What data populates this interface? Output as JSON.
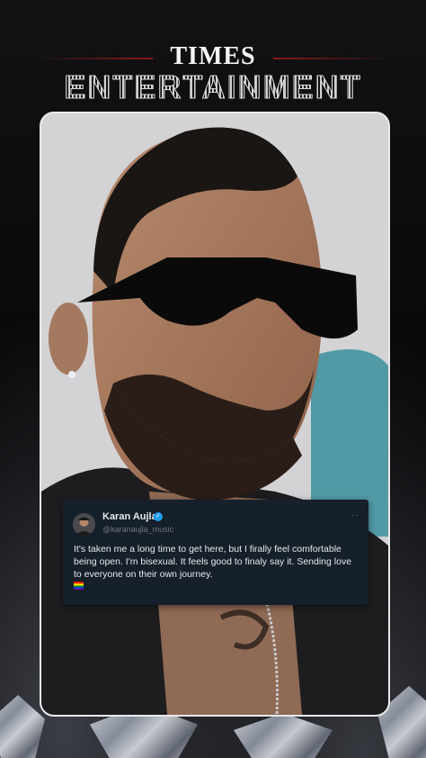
{
  "brand": {
    "line1": "TIMES",
    "line2": "ENTERTAINMENT"
  },
  "tweet": {
    "name": "Karan Aujla",
    "handle": "@karanaujla_music",
    "text": "It's taken me a long time to get here, but I firally feel comfortable being open. I'm bisexual. It feels good to finaly say it. Sending love to everyone on their own journey.",
    "emoji": "pride-flag",
    "verified_icon": "verified-badge-icon",
    "menu": "··"
  },
  "colors": {
    "background": "#0b0b0d",
    "accent_line": "#8b1a1a",
    "tweet_bg": "#15202b",
    "verified": "#1d9bf0"
  }
}
